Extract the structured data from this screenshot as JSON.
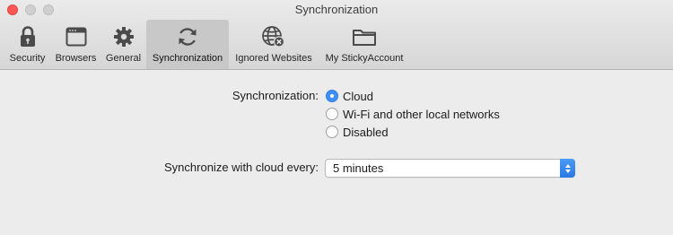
{
  "window": {
    "title": "Synchronization"
  },
  "toolbar": {
    "tabs": [
      {
        "label": "Security",
        "icon": "lock-icon"
      },
      {
        "label": "Browsers",
        "icon": "browser-window-icon"
      },
      {
        "label": "General",
        "icon": "gear-icon"
      },
      {
        "label": "Synchronization",
        "icon": "sync-icon",
        "selected": true
      },
      {
        "label": "Ignored Websites",
        "icon": "globe-blocked-icon"
      },
      {
        "label": "My StickyAccount",
        "icon": "folder-icon"
      }
    ]
  },
  "sync": {
    "label": "Synchronization:",
    "options": [
      {
        "label": "Cloud",
        "selected": true
      },
      {
        "label": "Wi-Fi and other local networks",
        "selected": false
      },
      {
        "label": "Disabled",
        "selected": false
      }
    ]
  },
  "interval": {
    "label": "Synchronize with cloud every:",
    "value": "5 minutes"
  },
  "colors": {
    "accent": "#3d8ef6",
    "close_button": "#fc5753",
    "background": "#ececec"
  }
}
